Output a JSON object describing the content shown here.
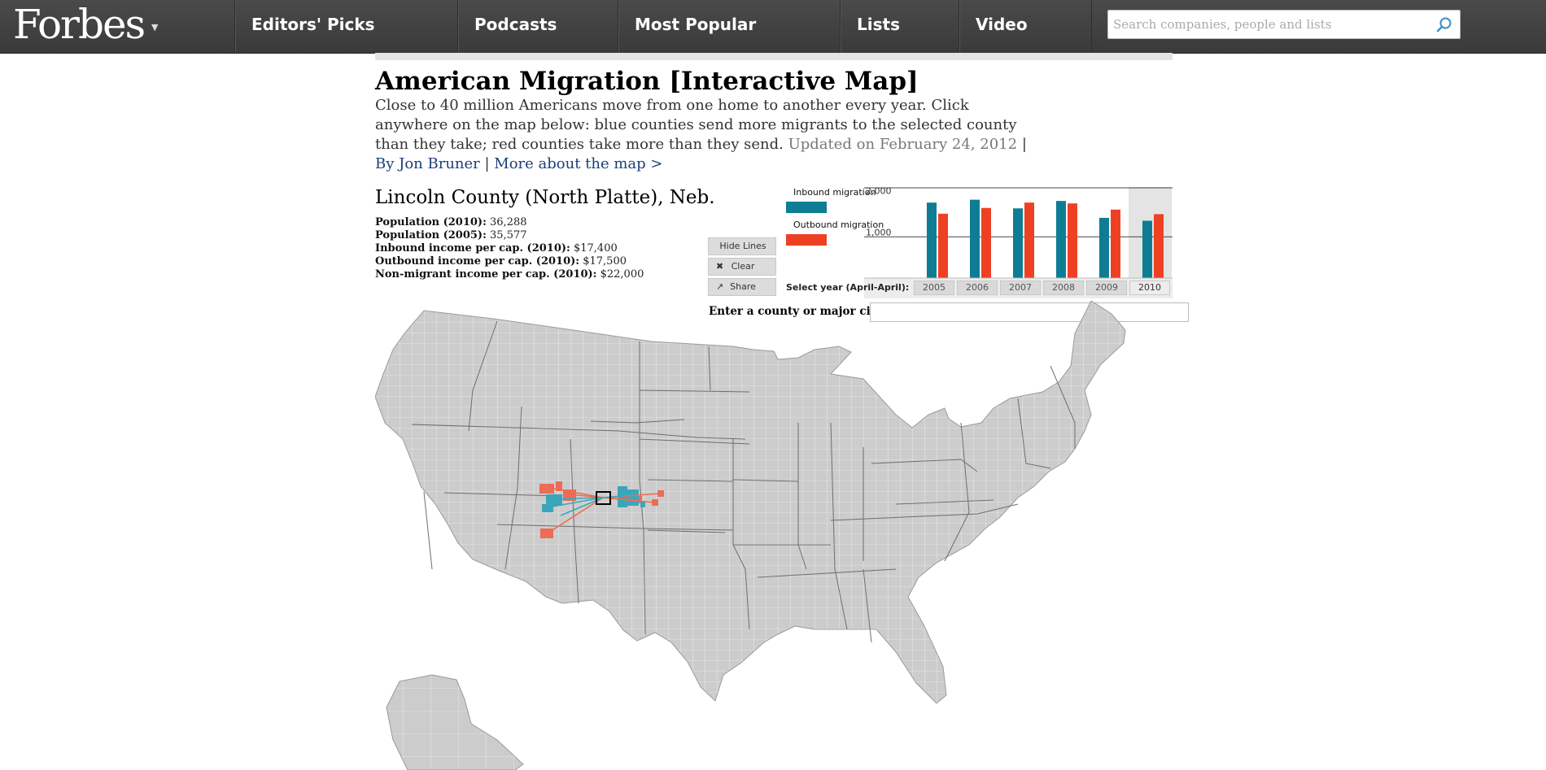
{
  "nav": {
    "logo": "Forbes",
    "items": [
      "Editors' Picks",
      "Podcasts",
      "Most Popular",
      "Lists",
      "Video"
    ],
    "search_placeholder": "Search companies, people and lists"
  },
  "article": {
    "title": "American Migration [Interactive Map]",
    "intro": "Close to 40 million Americans move from one home to another every year. Click anywhere on the map below: blue counties send more migrants to the selected county than they take; red counties take more than they send.",
    "updated": "Updated on February 24, 2012",
    "sep1": " | ",
    "byline": "By Jon Bruner",
    "sep2": " | ",
    "more_link": "More about the map >"
  },
  "county": {
    "name": "Lincoln County (North Platte), Neb.",
    "stats": [
      {
        "label": "Population (2010):",
        "value": "36,288"
      },
      {
        "label": "Population (2005):",
        "value": "35,577"
      },
      {
        "label": "Inbound income per cap. (2010):",
        "value": "$17,400"
      },
      {
        "label": "Outbound income per cap. (2010):",
        "value": "$17,500"
      },
      {
        "label": "Non-migrant income per cap. (2010):",
        "value": "$22,000"
      }
    ]
  },
  "controls": {
    "hide_lines": "Hide Lines",
    "clear": "Clear",
    "share": "Share",
    "lookup_label": "Enter a county or major city:",
    "lookup_value": ""
  },
  "colors": {
    "inbound": "#0e7d93",
    "outbound": "#ee4123",
    "map_land": "#cccccc",
    "nav_bg": "#444444"
  },
  "chart_data": {
    "type": "bar",
    "categories": [
      "2005",
      "2006",
      "2007",
      "2008",
      "2009",
      "2010"
    ],
    "series": [
      {
        "name": "Inbound migration",
        "values": [
          1830,
          1900,
          1690,
          1870,
          1460,
          1390
        ]
      },
      {
        "name": "Outbound migration",
        "values": [
          1560,
          1700,
          1830,
          1810,
          1660,
          1550
        ]
      }
    ],
    "ytick_labels": [
      "2,000",
      "1,000"
    ],
    "ylim": [
      0,
      2050
    ],
    "xlabel": "Select year (April-April):",
    "selected_year": "2010",
    "grid": true
  }
}
